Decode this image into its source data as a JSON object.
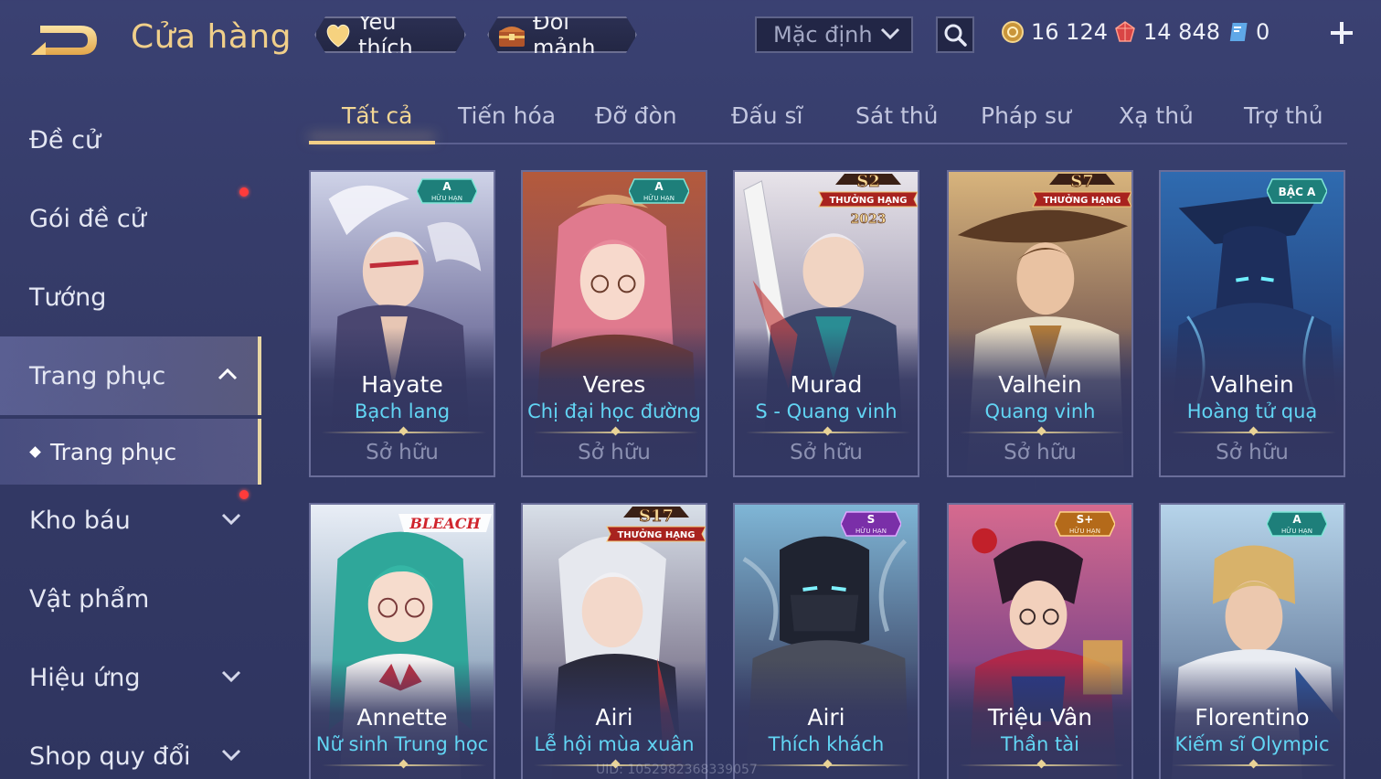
{
  "header": {
    "title": "Cửa hàng",
    "favorite_label": "Yêu thích",
    "shard_label": "Đổi mảnh",
    "sort_value": "Mặc định"
  },
  "currency": {
    "gold": "16 124",
    "ruby": "14 848",
    "voucher": "0"
  },
  "sidebar": {
    "items": [
      {
        "label": "Đề cử"
      },
      {
        "label": "Gói đề cử"
      },
      {
        "label": "Tướng"
      },
      {
        "label": "Trang phục"
      },
      {
        "label": "Kho báu"
      },
      {
        "label": "Vật phẩm"
      },
      {
        "label": "Hiệu ứng"
      },
      {
        "label": "Shop quy đổi"
      }
    ],
    "sub_item": "Trang phục"
  },
  "tabs": [
    "Tất cả",
    "Tiến hóa",
    "Đỡ đòn",
    "Đấu sĩ",
    "Sát thủ",
    "Pháp sư",
    "Xạ thủ",
    "Trợ thủ"
  ],
  "cards": [
    {
      "hero": "Hayate",
      "skin": "Bạch lang",
      "status": "Sở hữu",
      "badge_main": "A",
      "badge_sub": "HỮU HẠN"
    },
    {
      "hero": "Veres",
      "skin": "Chị đại học đường",
      "status": "Sở hữu",
      "badge_main": "A",
      "badge_sub": "HỮU HẠN"
    },
    {
      "hero": "Murad",
      "skin": "S - Quang vinh",
      "status": "Sở hữu",
      "badge_main": "S2",
      "badge_sub": "THƯỞNG HẠNG",
      "badge_year": "2023"
    },
    {
      "hero": "Valhein",
      "skin": "Quang vinh",
      "status": "Sở hữu",
      "badge_main": "S7",
      "badge_sub": "THƯỞNG HẠNG"
    },
    {
      "hero": "Valhein",
      "skin": "Hoàng tử quạ",
      "status": "Sở hữu",
      "badge_main": "BẬC A"
    },
    {
      "hero": "Annette",
      "skin": "Nữ sinh Trung học",
      "status": "",
      "badge_main": "BLEACH"
    },
    {
      "hero": "Airi",
      "skin": "Lễ hội mùa xuân",
      "status": "",
      "badge_main": "S17",
      "badge_sub": "THƯỞNG HẠNG"
    },
    {
      "hero": "Airi",
      "skin": "Thích khách",
      "status": "",
      "badge_main": "S",
      "badge_sub": "HỮU HẠN"
    },
    {
      "hero": "Triệu Vân",
      "skin": "Thần tài",
      "status": "",
      "badge_main": "S+",
      "badge_sub": "HỮU HẠN"
    },
    {
      "hero": "Florentino",
      "skin": "Kiếm sĩ Olympic",
      "status": "",
      "badge_main": "A",
      "badge_sub": "HỮU HẠN"
    }
  ],
  "uid_text": "UID: 1052982368339057",
  "colors": {
    "accent_gold": "#f2cf86",
    "skin_name": "#62d5f4",
    "owned_text": "#8c91b2",
    "background": "#363c6a"
  },
  "icons": {
    "back": "back-arrow-icon",
    "favorite": "heart-icon",
    "shard": "treasure-chest-icon",
    "search": "search-icon",
    "gold": "gold-coin-icon",
    "ruby": "ruby-icon",
    "voucher": "voucher-icon",
    "plus": "plus-icon"
  }
}
